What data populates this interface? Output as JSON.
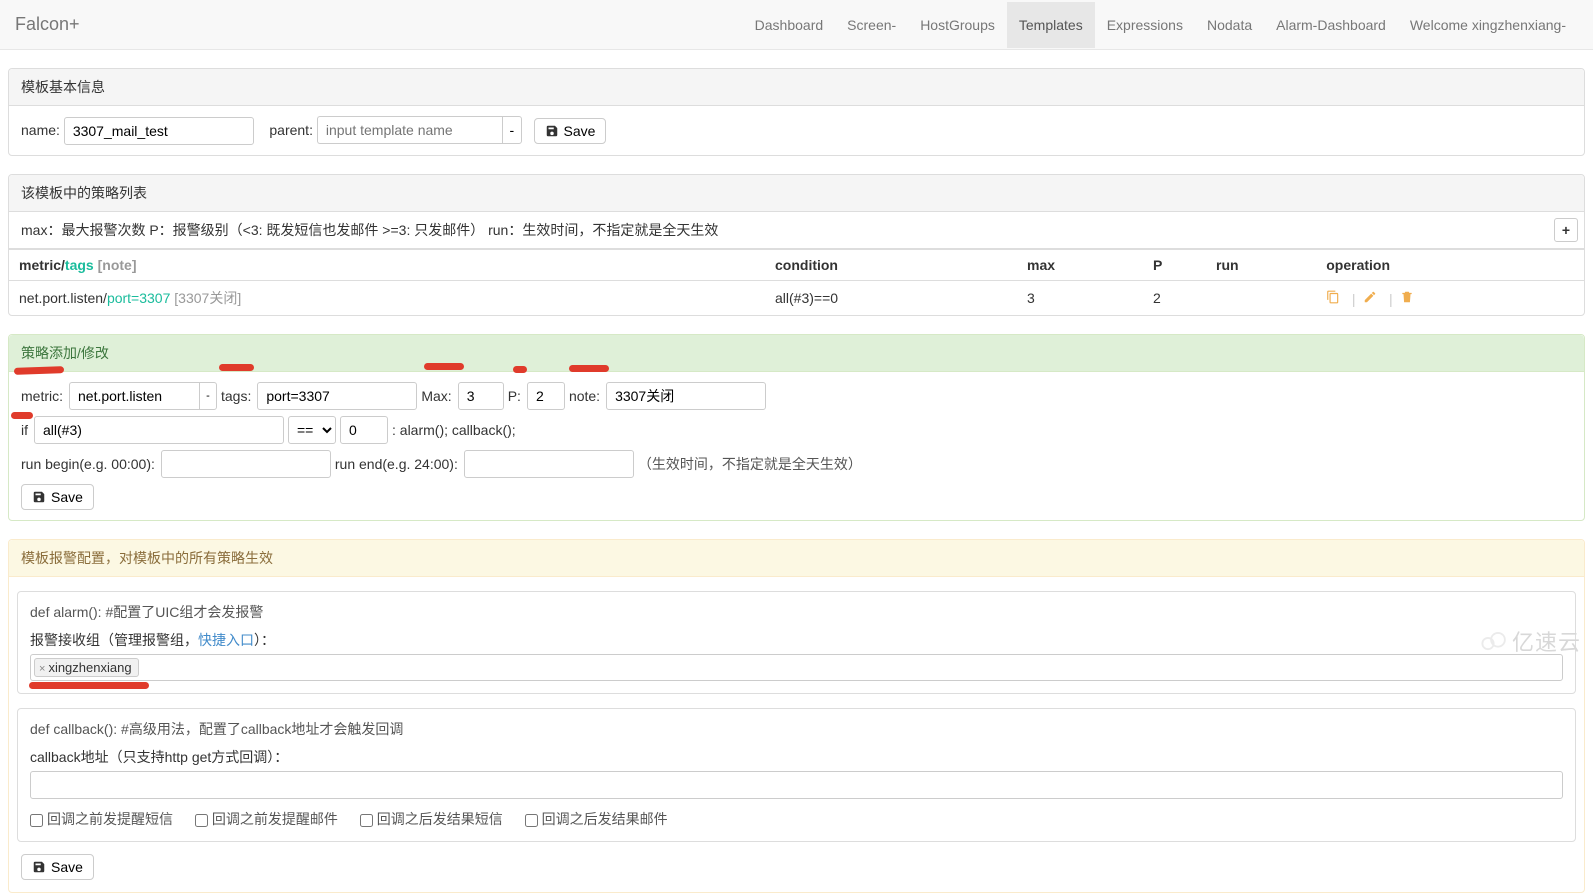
{
  "brand": "Falcon+",
  "nav": {
    "items": [
      "Dashboard",
      "Screen-",
      "HostGroups",
      "Templates",
      "Expressions",
      "Nodata",
      "Alarm-Dashboard",
      "Welcome xingzhenxiang-"
    ],
    "active_index": 3
  },
  "panel_basic": {
    "title": "模板基本信息",
    "name_label": "name:",
    "name_value": "3307_mail_test",
    "parent_label": "parent:",
    "parent_placeholder": "input template name",
    "save": "Save"
  },
  "panel_list": {
    "title": "该模板中的策略列表",
    "legend": "max：最大报警次数 P：报警级别（<3: 既发短信也发邮件 >=3: 只发邮件） run：生效时间，不指定就是全天生效",
    "plus": "+",
    "headers": {
      "metric": "metric/",
      "tags": "tags",
      "note": "[note]",
      "condition": "condition",
      "max": "max",
      "p": "P",
      "run": "run",
      "operation": "operation"
    },
    "rows": [
      {
        "metric": "net.port.listen/",
        "tags": "port=3307",
        "note": "[3307关闭]",
        "condition": "all(#3)==0",
        "max": "3",
        "p": "2",
        "run": ""
      }
    ]
  },
  "panel_edit": {
    "title": "策略添加/修改",
    "metric_label": "metric:",
    "metric_value": "net.port.listen",
    "tags_label": "tags:",
    "tags_value": "port=3307",
    "max_label": "Max:",
    "max_value": "3",
    "p_label": "P:",
    "p_value": "2",
    "note_label": "note:",
    "note_value": "3307关闭",
    "if_label": "if",
    "if_value": "all(#3)",
    "op_value": "==",
    "threshold_value": "0",
    "after": ": alarm(); callback();",
    "run_begin_label": "run begin(e.g. 00:00):",
    "run_end_label": "run end(e.g. 24:00):",
    "run_note": "（生效时间，不指定就是全天生效）",
    "save": "Save"
  },
  "panel_alarm": {
    "title": "模板报警配置，对模板中的所有策略生效",
    "alarm_def": "def alarm(): #配置了UIC组才会发报警",
    "recv_label": "报警接收组（管理报警组，",
    "recv_link": "快捷入口",
    "recv_label_after": "）：",
    "recv_token": "xingzhenxiang",
    "callback_def": "def callback(): #高级用法，配置了callback地址才会触发回调",
    "callback_label": "callback地址（只支持http get方式回调）：",
    "cb_options": [
      "回调之前发提醒短信",
      "回调之前发提醒邮件",
      "回调之后发结果短信",
      "回调之后发结果邮件"
    ],
    "save": "Save"
  },
  "watermark": "亿速云"
}
